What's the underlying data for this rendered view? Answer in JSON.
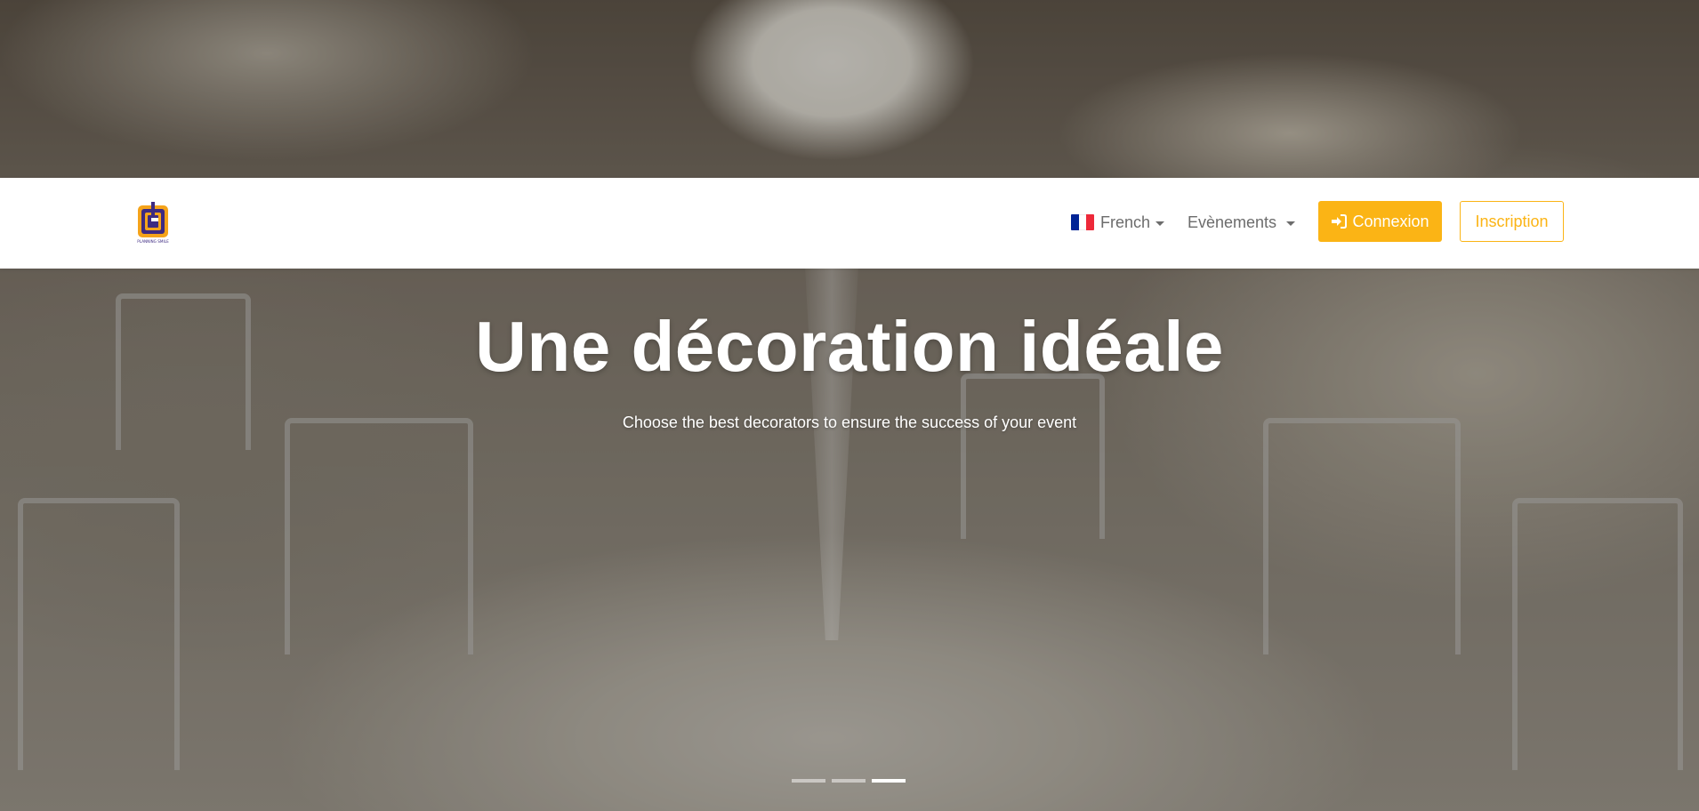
{
  "navbar": {
    "logo_caption": "PLANNING SMILE",
    "language": {
      "label": "French",
      "flag_colors": [
        "#002395",
        "#ffffff",
        "#ed2939"
      ]
    },
    "events_menu": {
      "label": "Evènements"
    },
    "login_button": {
      "label": "Connexion",
      "icon": "sign-in-icon"
    },
    "signup_button": {
      "label": "Inscription"
    }
  },
  "hero": {
    "title": "Une décoration idéale",
    "subtitle": "Choose the best decorators to ensure the success of your event",
    "slides_count": 3,
    "active_slide": 3
  },
  "colors": {
    "accent": "#fbb415",
    "nav_text": "#6c6c6c",
    "logo_purple": "#3d2a82",
    "logo_orange": "#f5a31a"
  }
}
